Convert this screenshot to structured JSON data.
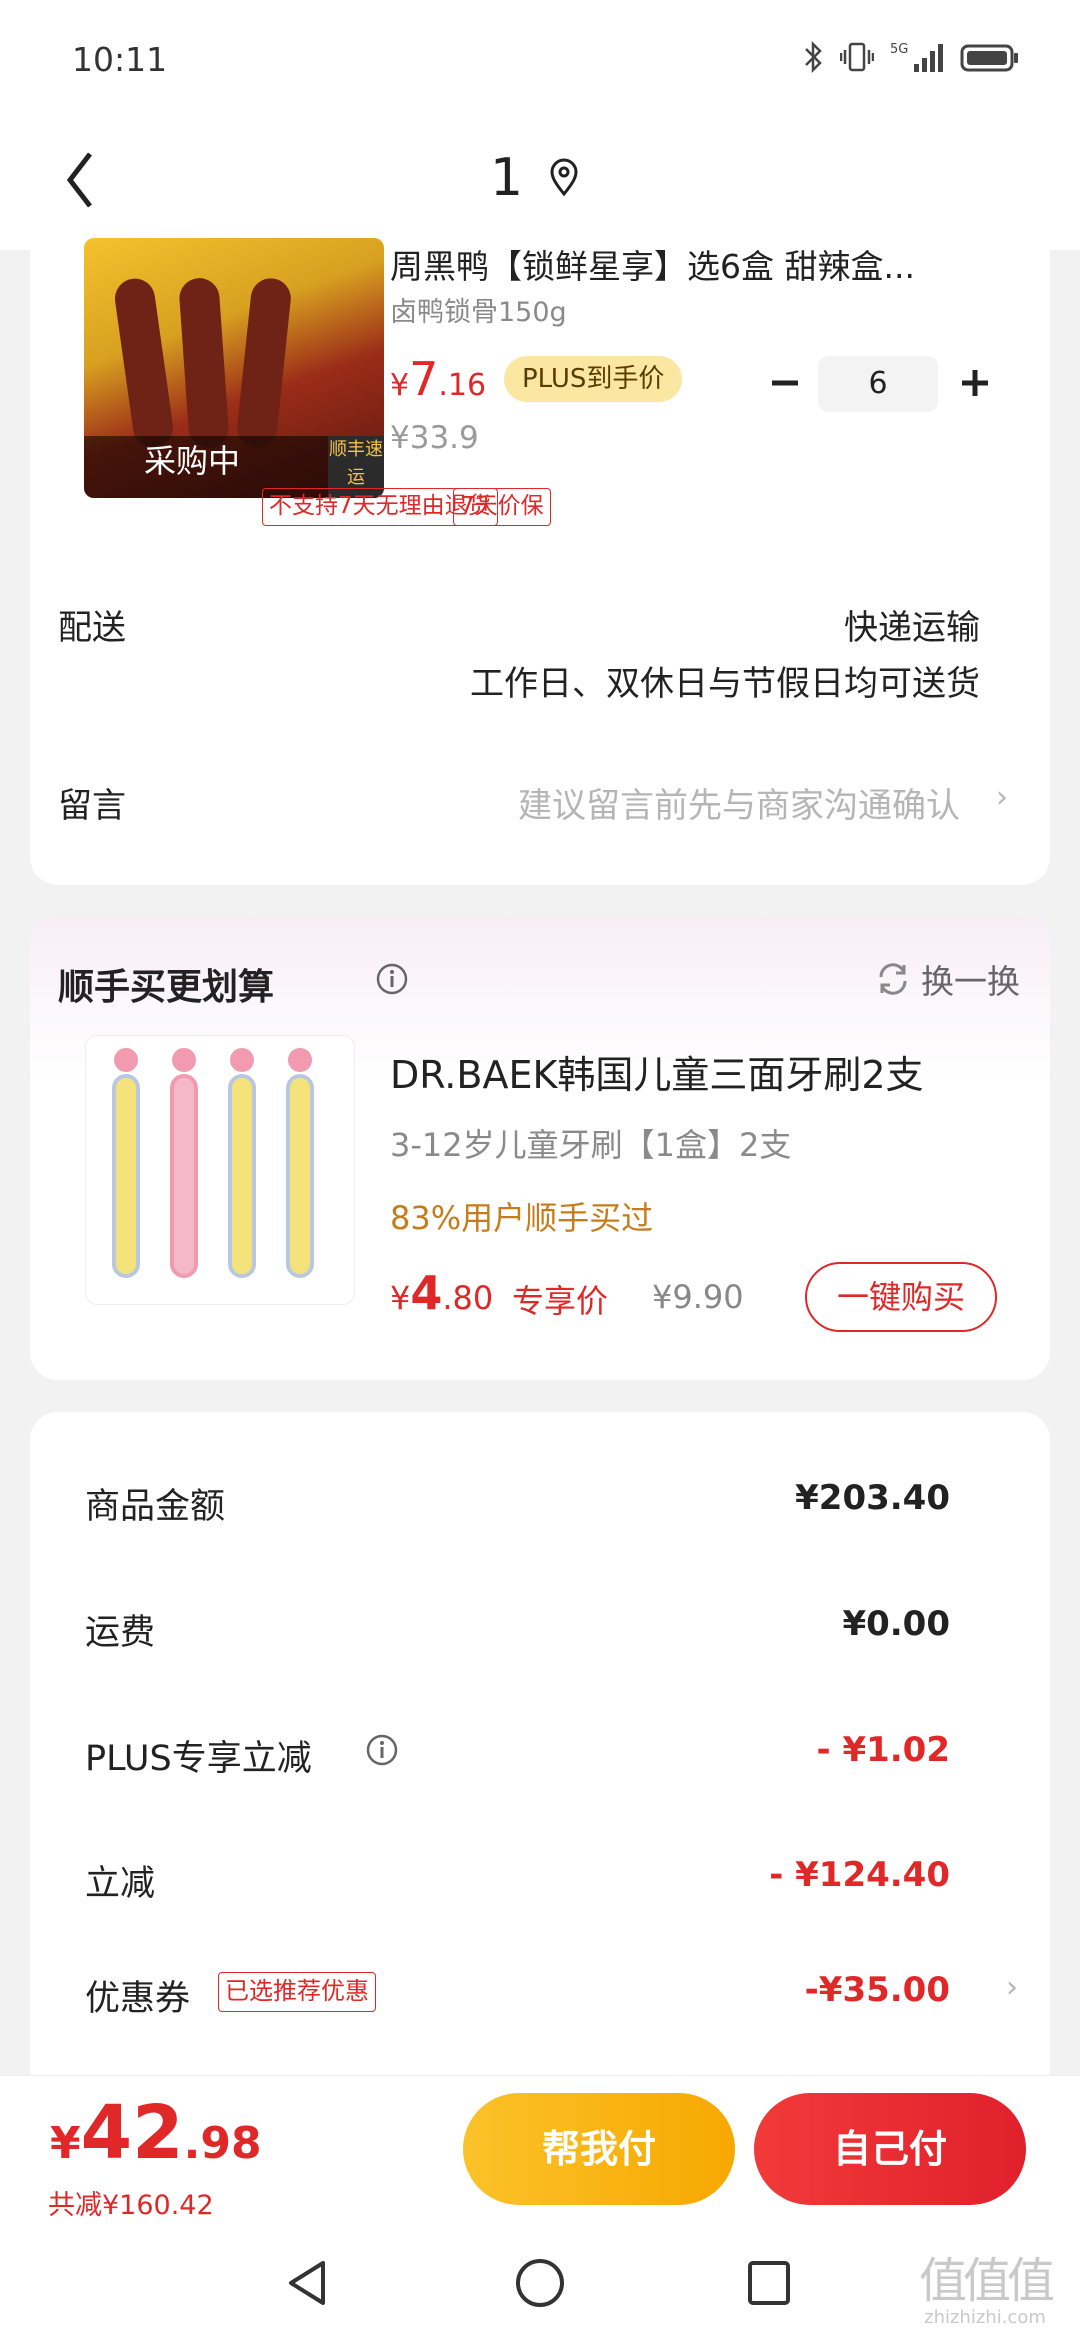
{
  "status_bar": {
    "time": "10:11",
    "icons": [
      "bluetooth-icon",
      "vibrate-icon",
      "signal-5g-icon",
      "battery-icon"
    ],
    "network": "5G"
  },
  "nav": {
    "title": "1",
    "back": "back-icon",
    "location": "location-icon"
  },
  "product": {
    "title": "周黑鸭【锁鲜星享】选6盒 甜辣盒...",
    "spec": "卤鸭锁骨150g",
    "price_symbol": "¥",
    "price_int": "7",
    "price_dec": ".16",
    "plus_tag": "PLUS到手价",
    "orig_price": "¥33.9",
    "quantity": "6",
    "image_label": "采购中",
    "image_corner": "顺丰速运",
    "tags": [
      "不支持7天无理由退货",
      "7天价保"
    ]
  },
  "delivery": {
    "label": "配送",
    "method": "快递运输",
    "schedule": "工作日、双休日与节假日均可送货"
  },
  "message": {
    "label": "留言",
    "placeholder": "建议留言前先与商家沟通确认"
  },
  "addon": {
    "title": "顺手买更划算",
    "refresh": "换一换",
    "item_title": "DR.BAEK韩国儿童三面牙刷2支",
    "item_sub": "3-12岁儿童牙刷【1盒】2支",
    "item_pct": "83%用户顺手买过",
    "price_symbol": "¥",
    "price_int": "4",
    "price_dec": ".80",
    "excl": "专享价",
    "orig": "¥9.90",
    "buy": "一键购买"
  },
  "summary": [
    {
      "label": "商品金额",
      "value": "¥203.40",
      "red": false
    },
    {
      "label": "运费",
      "value": "¥0.00",
      "red": false
    },
    {
      "label": "PLUS专享立减",
      "value": "- ¥1.02",
      "red": true
    },
    {
      "label": "立减",
      "value": "- ¥124.40",
      "red": true
    },
    {
      "label": "优惠券",
      "value": "-¥35.00",
      "red": true
    }
  ],
  "coupon_tag": "已选推荐优惠",
  "checkout": {
    "symbol": "¥",
    "total_int": "42",
    "total_dec": ".98",
    "total_saved": "共减¥160.42",
    "help_pay": "帮我付",
    "self_pay": "自己付"
  },
  "watermark": {
    "line1": "值值值",
    "line2": "zhizhizhi.com"
  },
  "colors": {
    "accent_red": "#e02828",
    "plus_gold": "#fbe7a2",
    "help_pay": "#f7a800",
    "self_pay": "#e0202b"
  }
}
